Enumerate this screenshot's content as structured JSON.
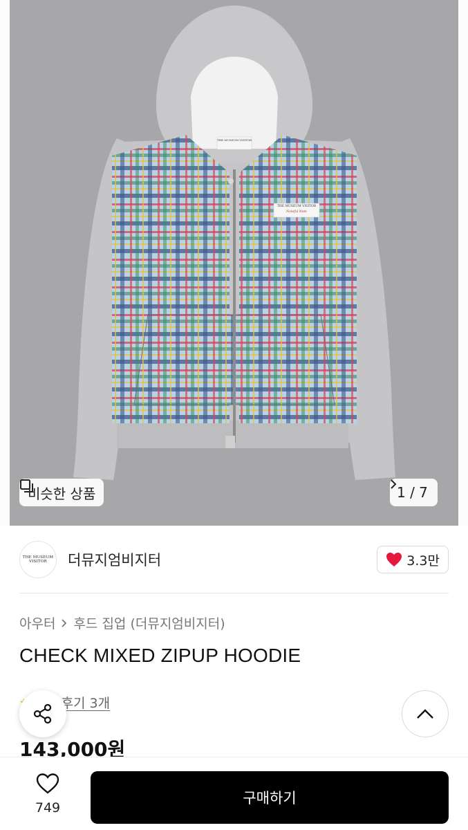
{
  "gallery": {
    "similar_label": "비슷한 상품",
    "counter": "1 / 7",
    "label_brand": "THE MUSEUM VISITOR",
    "label_script": "Noteful Note"
  },
  "shop": {
    "name": "더뮤지엄비지터",
    "logo_text": "THE MUSEUM VISITOR",
    "likes": "3.3만"
  },
  "product": {
    "breadcrumb": [
      "아우터",
      "후드 집업 (더뮤지엄비지터)"
    ],
    "title": "CHECK MIXED ZIPUP HOODIE",
    "review_label": "후기 3개",
    "price": "143,000원"
  },
  "bottom": {
    "wish_count": "749",
    "buy_label": "구매하기"
  },
  "colors": {
    "accent": "#000000",
    "heart": "#e5173f",
    "photo_bg": "#a7a7a9"
  }
}
